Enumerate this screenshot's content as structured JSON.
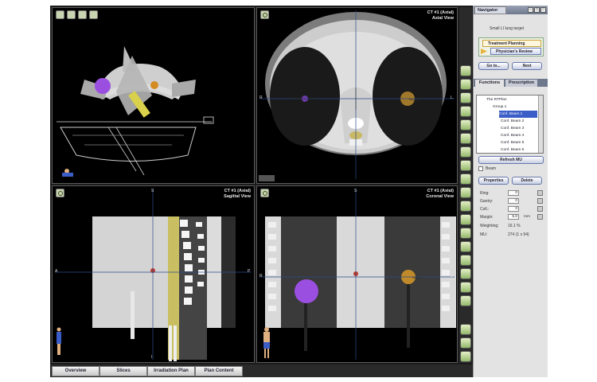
{
  "axial": {
    "title_line1": "CT #1 (Axial)",
    "title_line2": "Axial View",
    "left_marker": "R",
    "right_marker": "L",
    "target_label": "Target 1"
  },
  "sagittal": {
    "title_line1": "CT #1 (Axial)",
    "title_line2": "Sagittal View",
    "left_marker": "A",
    "right_marker": "P",
    "top_marker": "S",
    "bottom_marker": "I"
  },
  "coronal": {
    "title_line1": "CT #1 (Axial)",
    "title_line2": "Coronal View",
    "left_marker": "R",
    "right_marker": "L",
    "top_marker": "S",
    "target_label": "Target 1"
  },
  "bottom_tabs": [
    "Overview",
    "Slices",
    "Irradiation Plan",
    "Plan Content"
  ],
  "navigator": {
    "tab_label": "Navigator",
    "target_name": "Small LI lung target",
    "step_treatment": "Treatment Planning",
    "step_review": "Physician's Review",
    "goto_button": "Go to...",
    "next_button": "Next"
  },
  "functions": {
    "tabs": [
      "Functions",
      "Prescription"
    ],
    "tree": {
      "root": "The RTPlan",
      "group": "Group 1",
      "beams": [
        "Conf. Beam 1",
        "Conf. Beam 2",
        "Conf. Beam 3",
        "Conf. Beam 4",
        "Conf. Beam 5",
        "Conf. Beam 6"
      ]
    },
    "refresh_button": "Refresh MU",
    "beam_checkbox_label": "Beam",
    "properties_button": "Properties",
    "delete_button": "Delete",
    "fields": [
      {
        "label": "Ring:",
        "value": "0"
      },
      {
        "label": "Gantry:",
        "value": "0"
      },
      {
        "label": "Coll.:",
        "value": "0"
      },
      {
        "label": "Margin:",
        "value": "5.0",
        "unit": "mm"
      }
    ],
    "weighting_label": "Weighting:",
    "weighting_value": "16.1 %",
    "mu_label": "MU:",
    "mu_value": "274 (1 x 54)"
  }
}
